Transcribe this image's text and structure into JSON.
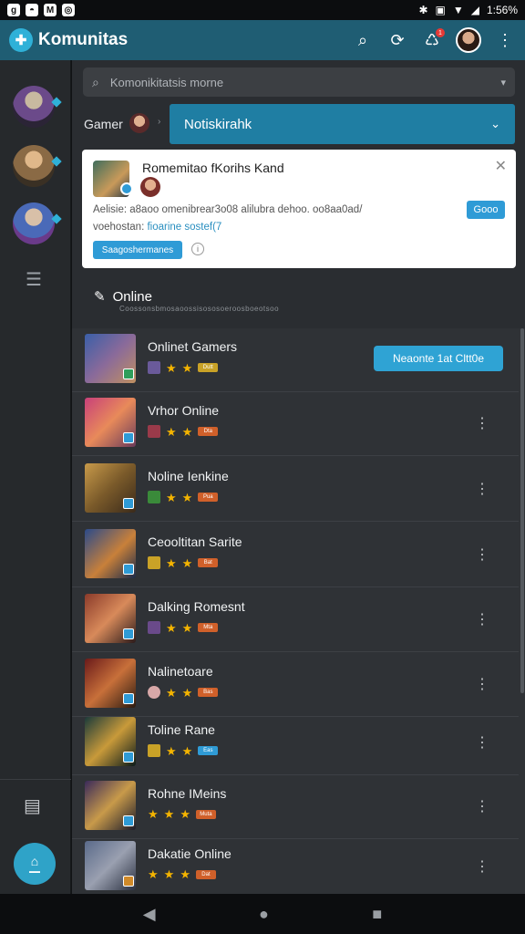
{
  "status": {
    "left_icons": [
      "g",
      "◓",
      "M",
      "◎"
    ],
    "battery": "1:56%"
  },
  "app_bar": {
    "title": "Komunitas",
    "notif_count": "1"
  },
  "search": {
    "placeholder": "Komonikitatsis morne"
  },
  "filter": {
    "label": "Gamer",
    "dropdown_value": "Notiskirahk"
  },
  "card": {
    "title": "Romemitao fKorihs Kand",
    "text1": "Aelisie: a8aoo omenibrear3o08 alilubra dehoo. oo8aa0ad/",
    "text2_prefix": "voehostan: ",
    "text2_link": "fioarine sostef(7",
    "small_button": "Gooo",
    "button": "Saagoshermanes",
    "info": "i"
  },
  "online": {
    "title": "Online",
    "subtitle": "Coossonsbmosaoossisososoeroosboeotsoo"
  },
  "games": [
    {
      "title": "Onlinet Gamers",
      "tag": "Dutt",
      "button": "Neaonte 1at Cltt0e"
    },
    {
      "title": "Vrhor Online",
      "tag": "Dta"
    },
    {
      "title": "Noline Ienkine",
      "tag": "Pua"
    },
    {
      "title": "Ceooltitan Sarite",
      "tag": "Bat"
    },
    {
      "title": "Dalking Romesnt",
      "tag": "Mta"
    },
    {
      "title": "Nalinetoare",
      "tag": "Bas"
    },
    {
      "title": "Toline Rane",
      "tag": "Eas"
    },
    {
      "title": "Rohne IMeins",
      "tag": "Muta"
    },
    {
      "title": "Dakatie Online",
      "tag": "Dat"
    }
  ],
  "colors": {
    "accent": "#2fa3d4",
    "app_bar": "#1f5d73",
    "star": "#f4b400"
  }
}
